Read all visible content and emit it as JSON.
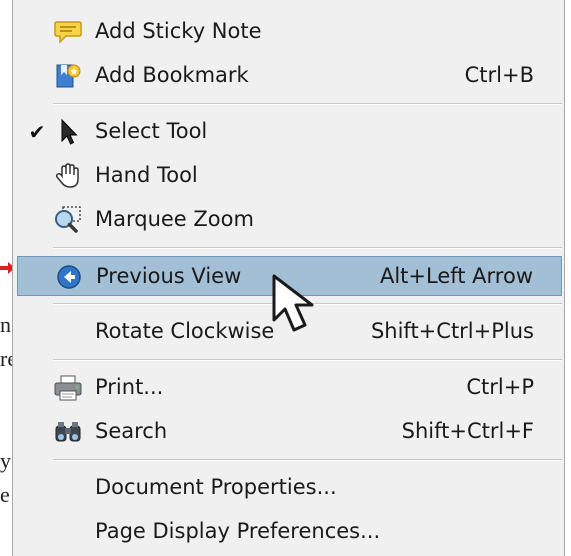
{
  "menu": {
    "items": [
      {
        "label": "Add Sticky Note",
        "shortcut": "",
        "icon": "sticky-note-icon"
      },
      {
        "label": "Add Bookmark",
        "shortcut": "Ctrl+B",
        "icon": "bookmark-icon"
      },
      {
        "label": "Select Tool",
        "shortcut": "",
        "icon": "arrow-select-icon",
        "checked": "✔"
      },
      {
        "label": "Hand Tool",
        "shortcut": "",
        "icon": "hand-icon"
      },
      {
        "label": "Marquee Zoom",
        "shortcut": "",
        "icon": "marquee-zoom-icon"
      },
      {
        "label": "Previous View",
        "shortcut": "Alt+Left Arrow",
        "icon": "previous-view-icon",
        "highlighted": true
      },
      {
        "label": "Rotate Clockwise",
        "shortcut": "Shift+Ctrl+Plus",
        "icon": ""
      },
      {
        "label": "Print...",
        "shortcut": "Ctrl+P",
        "icon": "printer-icon"
      },
      {
        "label": "Search",
        "shortcut": "Shift+Ctrl+F",
        "icon": "binoculars-icon"
      },
      {
        "label": "Document Properties...",
        "shortcut": "",
        "icon": ""
      },
      {
        "label": "Page Display Preferences...",
        "shortcut": "",
        "icon": ""
      }
    ]
  },
  "background_fragments": [
    "n",
    "re",
    "y",
    "e"
  ],
  "colors": {
    "menu_bg": "#f0f0f0",
    "highlight_bg": "#a3bfd6",
    "highlight_border": "#6f96bd",
    "annotation_arrow": "#e02020"
  }
}
